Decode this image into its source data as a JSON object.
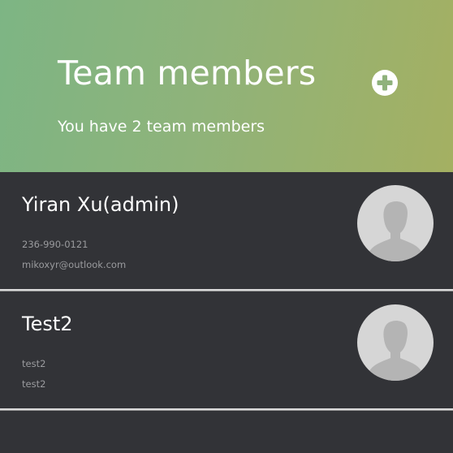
{
  "header": {
    "title": "Team members",
    "subtitle": "You have 2 team members",
    "add_icon": "plus-circle-icon"
  },
  "members": [
    {
      "name": "Yiran Xu(admin)",
      "phone": "236-990-0121",
      "email": "mikoxyr@outlook.com",
      "avatar_icon": "default-user-avatar"
    },
    {
      "name": "Test2",
      "phone": "test2",
      "email": "test2",
      "avatar_icon": "default-user-avatar"
    }
  ],
  "colors": {
    "header_gradient_start": "#7db584",
    "header_gradient_end": "#a4b062",
    "background": "#323337",
    "detail_text": "#9a9b9e"
  }
}
